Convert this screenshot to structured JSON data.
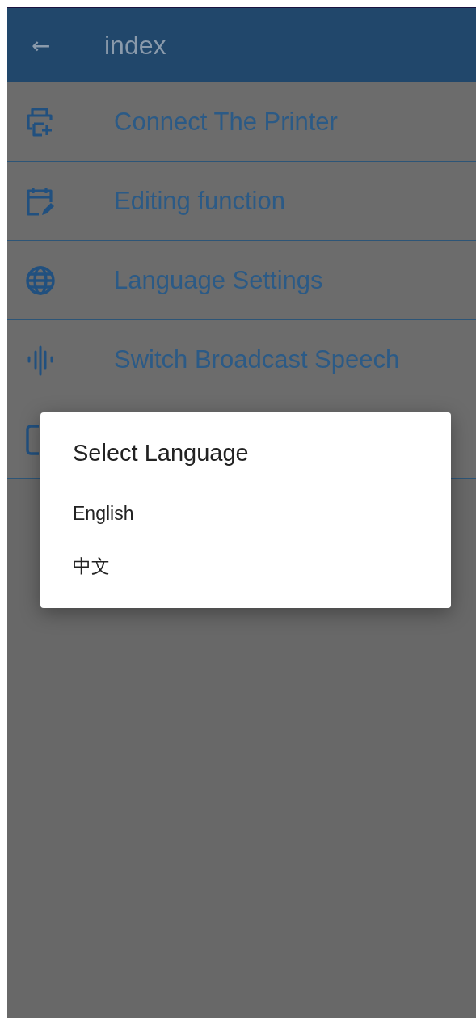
{
  "app_bar": {
    "back_icon": "←",
    "title": "index"
  },
  "menu": [
    {
      "kind": "printer",
      "label": "Connect The Printer"
    },
    {
      "kind": "calendar-edit",
      "label": "Editing function"
    },
    {
      "kind": "globe",
      "label": "Language Settings"
    },
    {
      "kind": "waveform",
      "label": "Switch Broadcast Speech"
    },
    {
      "kind": "covered"
    }
  ],
  "dialog": {
    "title": "Select Language",
    "options": [
      {
        "label": "English"
      },
      {
        "label": "中文"
      }
    ]
  }
}
